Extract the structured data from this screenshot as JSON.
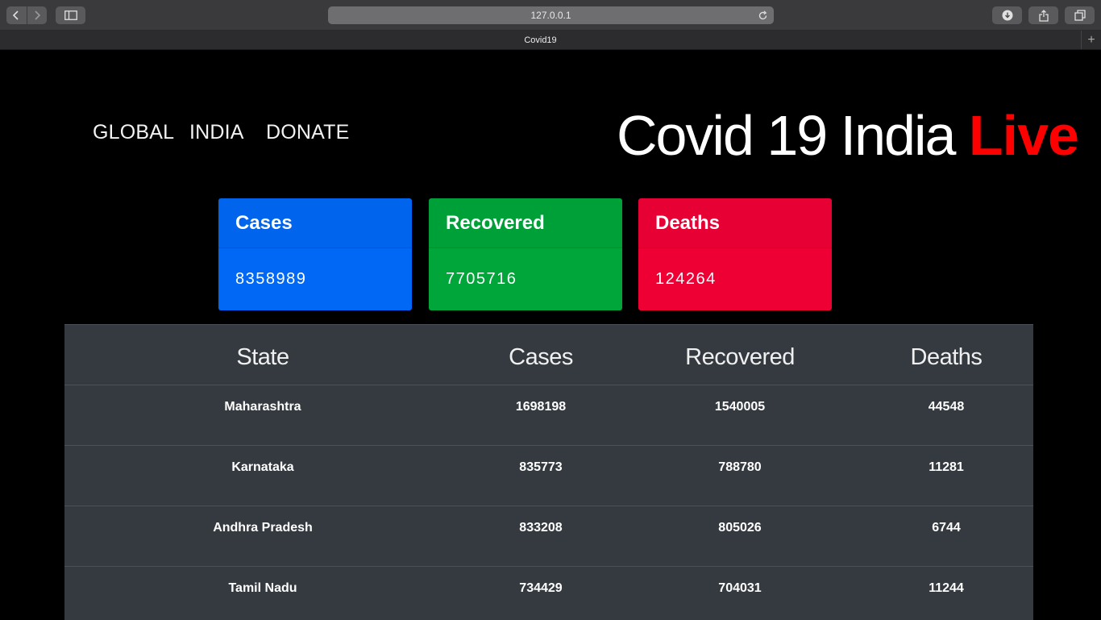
{
  "browser": {
    "url": "127.0.0.1",
    "tab_title": "Covid19"
  },
  "nav": {
    "items": [
      "GLOBAL",
      "INDIA",
      "DONATE"
    ]
  },
  "header": {
    "title_main": "Covid 19 India ",
    "title_accent": "Live"
  },
  "cards": [
    {
      "label": "Cases",
      "value": "8358989",
      "color": "#0068f5"
    },
    {
      "label": "Recovered",
      "value": "7705716",
      "color": "#00a63a"
    },
    {
      "label": "Deaths",
      "value": "124264",
      "color": "#ee0035"
    }
  ],
  "table": {
    "headers": [
      "State",
      "Cases",
      "Recovered",
      "Deaths"
    ],
    "rows": [
      [
        "Maharashtra",
        "1698198",
        "1540005",
        "44548"
      ],
      [
        "Karnataka",
        "835773",
        "788780",
        "11281"
      ],
      [
        "Andhra Pradesh",
        "833208",
        "805026",
        "6744"
      ],
      [
        "Tamil Nadu",
        "734429",
        "704031",
        "11244"
      ]
    ]
  }
}
